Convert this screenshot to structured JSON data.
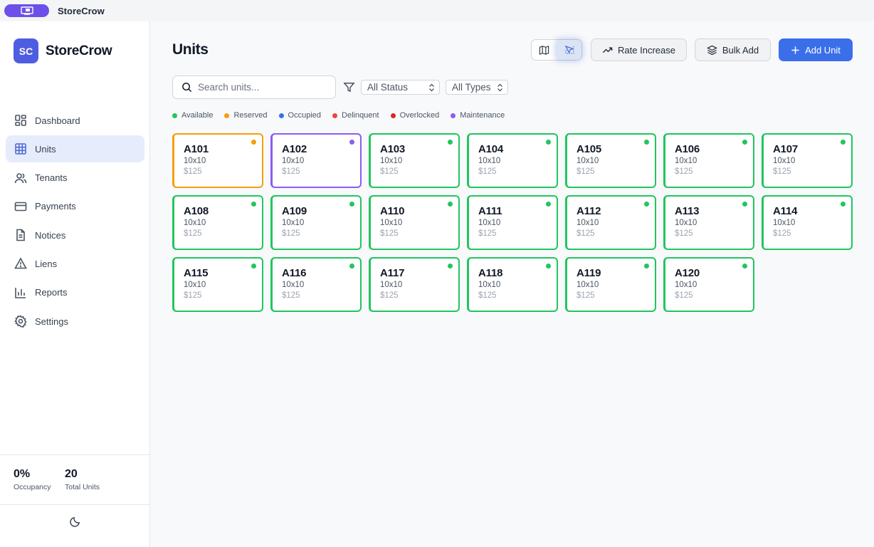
{
  "app": {
    "title": "StoreCrow"
  },
  "brand": {
    "initials": "SC",
    "name": "StoreCrow",
    "color": "#4f5de0"
  },
  "nav": [
    {
      "label": "Dashboard",
      "icon": "dashboard-icon",
      "active": false
    },
    {
      "label": "Units",
      "icon": "grid-icon",
      "active": true
    },
    {
      "label": "Tenants",
      "icon": "users-icon",
      "active": false
    },
    {
      "label": "Payments",
      "icon": "credit-card-icon",
      "active": false
    },
    {
      "label": "Notices",
      "icon": "document-icon",
      "active": false
    },
    {
      "label": "Liens",
      "icon": "warning-icon",
      "active": false
    },
    {
      "label": "Reports",
      "icon": "bar-chart-icon",
      "active": false
    },
    {
      "label": "Settings",
      "icon": "gear-icon",
      "active": false
    }
  ],
  "stats": {
    "occupancy": {
      "value": "0%",
      "label": "Occupancy"
    },
    "total_units": {
      "value": "20",
      "label": "Total Units"
    }
  },
  "page": {
    "title": "Units"
  },
  "toolbar": {
    "rate_increase_label": "Rate Increase",
    "bulk_add_label": "Bulk Add",
    "add_unit_label": "Add Unit",
    "view_modes": [
      "map-icon",
      "cursor-icon"
    ],
    "active_view": "cursor-icon"
  },
  "filters": {
    "search_placeholder": "Search units...",
    "status": "All Status",
    "types": "All Types"
  },
  "legend": [
    {
      "label": "Available",
      "color": "#22c55e"
    },
    {
      "label": "Reserved",
      "color": "#f59e0b"
    },
    {
      "label": "Occupied",
      "color": "#3b6fea"
    },
    {
      "label": "Delinquent",
      "color": "#ef4444"
    },
    {
      "label": "Overlocked",
      "color": "#dc2626"
    },
    {
      "label": "Maintenance",
      "color": "#8b5cf6"
    }
  ],
  "units": [
    {
      "name": "A101",
      "size": "10x10",
      "price": "$125",
      "status": "Reserved"
    },
    {
      "name": "A102",
      "size": "10x10",
      "price": "$125",
      "status": "Maintenance"
    },
    {
      "name": "A103",
      "size": "10x10",
      "price": "$125",
      "status": "Available"
    },
    {
      "name": "A104",
      "size": "10x10",
      "price": "$125",
      "status": "Available"
    },
    {
      "name": "A105",
      "size": "10x10",
      "price": "$125",
      "status": "Available"
    },
    {
      "name": "A106",
      "size": "10x10",
      "price": "$125",
      "status": "Available"
    },
    {
      "name": "A107",
      "size": "10x10",
      "price": "$125",
      "status": "Available"
    },
    {
      "name": "A108",
      "size": "10x10",
      "price": "$125",
      "status": "Available"
    },
    {
      "name": "A109",
      "size": "10x10",
      "price": "$125",
      "status": "Available"
    },
    {
      "name": "A110",
      "size": "10x10",
      "price": "$125",
      "status": "Available"
    },
    {
      "name": "A111",
      "size": "10x10",
      "price": "$125",
      "status": "Available"
    },
    {
      "name": "A112",
      "size": "10x10",
      "price": "$125",
      "status": "Available"
    },
    {
      "name": "A113",
      "size": "10x10",
      "price": "$125",
      "status": "Available"
    },
    {
      "name": "A114",
      "size": "10x10",
      "price": "$125",
      "status": "Available"
    },
    {
      "name": "A115",
      "size": "10x10",
      "price": "$125",
      "status": "Available"
    },
    {
      "name": "A116",
      "size": "10x10",
      "price": "$125",
      "status": "Available"
    },
    {
      "name": "A117",
      "size": "10x10",
      "price": "$125",
      "status": "Available"
    },
    {
      "name": "A118",
      "size": "10x10",
      "price": "$125",
      "status": "Available"
    },
    {
      "name": "A119",
      "size": "10x10",
      "price": "$125",
      "status": "Available"
    },
    {
      "name": "A120",
      "size": "10x10",
      "price": "$125",
      "status": "Available"
    }
  ]
}
